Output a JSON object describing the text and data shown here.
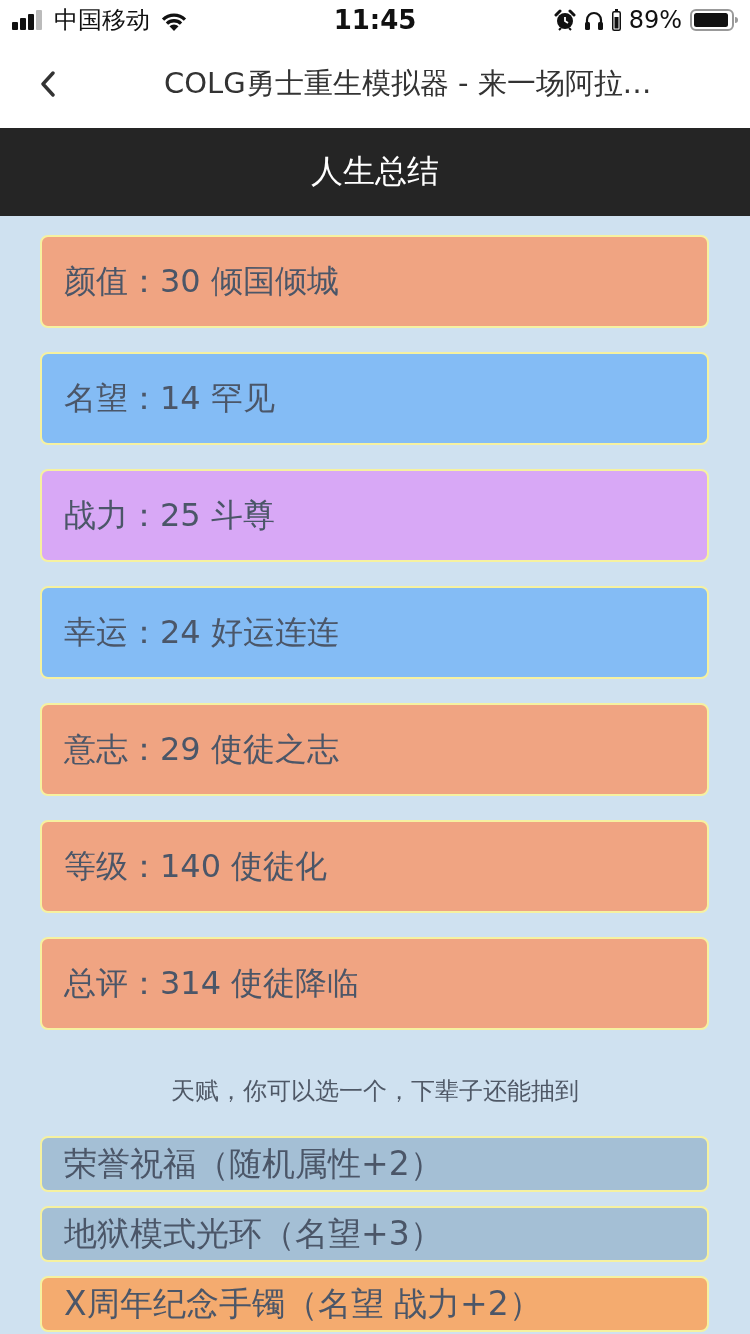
{
  "status_bar": {
    "carrier": "中国移动",
    "time": "11:45",
    "battery": "89%"
  },
  "nav_bar": {
    "title": "COLG勇士重生模拟器 - 来一场阿拉…"
  },
  "header": {
    "title": "人生总结"
  },
  "stats": [
    {
      "text": "颜值：30 倾国倾城",
      "color": "#f0a482"
    },
    {
      "text": "名望：14 罕见",
      "color": "#84bcf5"
    },
    {
      "text": "战力：25 斗尊",
      "color": "#d8a8f6"
    },
    {
      "text": "幸运：24 好运连连",
      "color": "#84bcf5"
    },
    {
      "text": "意志：29 使徒之志",
      "color": "#f0a482"
    },
    {
      "text": "等级：140 使徒化",
      "color": "#f0a482"
    },
    {
      "text": "总评：314 使徒降临",
      "color": "#f0a482"
    }
  ],
  "prompt": "天赋，你可以选一个，下辈子还能抽到",
  "talents": [
    {
      "name": "荣誉祝福（随机属性+2）",
      "color": "#a4bfd5"
    },
    {
      "name": "地狱模式光环（名望+3）",
      "color": "#a4bfd5"
    },
    {
      "name": "X周年纪念手镯（名望 战力+2）",
      "color": "#f4ab6f"
    }
  ]
}
